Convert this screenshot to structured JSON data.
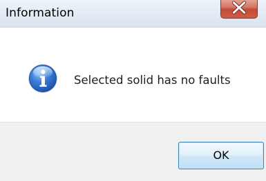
{
  "window": {
    "title": "Information"
  },
  "titlebar_controls": {
    "close_icon": "close-x-icon",
    "close_color": "#c24c39"
  },
  "message": {
    "icon": "information-icon",
    "text": "Selected solid has no faults"
  },
  "buttons": {
    "ok_label": "OK"
  },
  "colors": {
    "titlebar": "#e3ebf4",
    "footer": "#f0f0f0",
    "ok_button_border": "#3c7fb1",
    "info_icon_blue": "#2a67c9"
  }
}
